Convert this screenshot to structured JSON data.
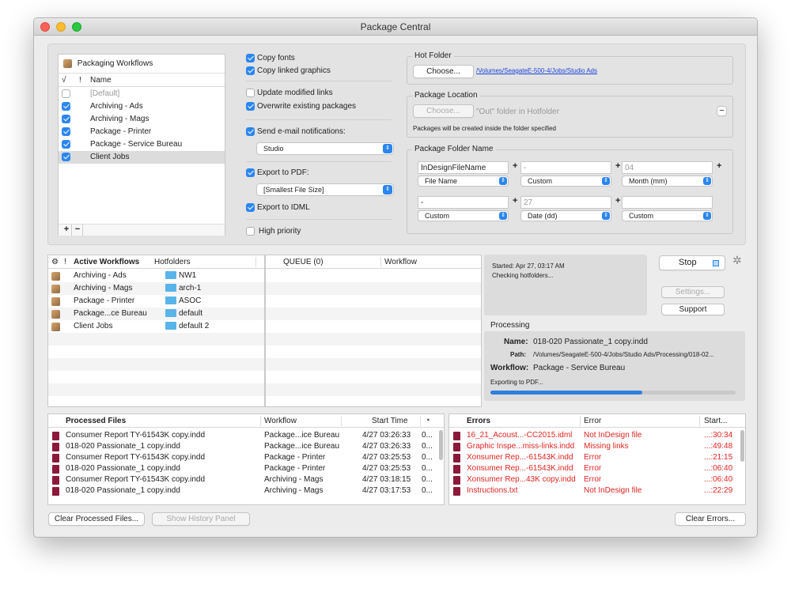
{
  "window": {
    "title": "Package Central"
  },
  "workflows": {
    "title": "Packaging Workflows",
    "col_check": "√",
    "col_bang": "!",
    "col_name": "Name",
    "items": [
      {
        "label": "[Default]",
        "checked": false
      },
      {
        "label": "Archiving - Ads",
        "checked": true
      },
      {
        "label": "Archiving - Mags",
        "checked": true
      },
      {
        "label": "Package - Printer",
        "checked": true
      },
      {
        "label": "Package - Service Bureau",
        "checked": true
      },
      {
        "label": "Client Jobs",
        "checked": true
      }
    ],
    "add_label": "+",
    "remove_label": "−"
  },
  "options": {
    "copy_fonts": "Copy fonts",
    "copy_graphics": "Copy linked graphics",
    "update_links": "Update modified links",
    "overwrite": "Overwrite existing packages",
    "send_email": "Send e-mail notifications:",
    "email_value": "Studio",
    "export_pdf": "Export to PDF:",
    "pdf_preset": "[Smallest File Size]",
    "export_idml": "Export to IDML",
    "high_priority": "High priority"
  },
  "hot_folder": {
    "legend": "Hot Folder",
    "choose": "Choose...",
    "path": "/Volumes/SeagateE-500-4/Jobs/Studio Ads"
  },
  "package_location": {
    "legend": "Package Location",
    "choose": "Choose...",
    "placeholder": "\"Out\" folder in Hotfolder",
    "note": "Packages will be created inside the folder specified",
    "remove": "−"
  },
  "folder_name": {
    "legend": "Package Folder Name",
    "plus": "+",
    "row1": [
      {
        "value": "InDesignFileName",
        "select": "File Name"
      },
      {
        "value": "-",
        "select": "Custom"
      },
      {
        "value": "04",
        "select": "Month (mm)"
      }
    ],
    "row2": [
      {
        "value": "-",
        "select": "Custom"
      },
      {
        "value": "27",
        "select": "Date (dd)"
      },
      {
        "value": "",
        "select": "Custom"
      }
    ]
  },
  "active": {
    "col_bang": "!",
    "col_active": "Active Workflows",
    "col_hot": "Hotfolders",
    "rows": [
      {
        "name": "Archiving - Ads",
        "folder": "NW1"
      },
      {
        "name": "Archiving - Mags",
        "folder": "arch-1"
      },
      {
        "name": "Package - Printer",
        "folder": "ASOC"
      },
      {
        "name": "Package...ce Bureau",
        "folder": "default"
      },
      {
        "name": "Client Jobs",
        "folder": "default 2"
      }
    ]
  },
  "queue": {
    "col_queue": "QUEUE (0)",
    "col_workflow": "Workflow"
  },
  "status": {
    "started": "Started: Apr 27, 03:17 AM",
    "checking": "Checking hotfolders...",
    "stop": "Stop",
    "settings": "Settings...",
    "support": "Support"
  },
  "processing": {
    "title": "Processing",
    "name_label": "Name:",
    "name_value": "018-020 Passionate_1 copy.indd",
    "path_label": "Path:",
    "path_value": "/Volumes/SeagateE-500-4/Jobs/Studio Ads/Processing/018-02...",
    "workflow_label": "Workflow:",
    "workflow_value": "Package - Service Bureau",
    "exporting": "Exporting to PDF...",
    "progress": 0.62
  },
  "processed": {
    "col_files": "Processed Files",
    "col_workflow": "Workflow",
    "col_start": "Start Time",
    "rows": [
      {
        "file": "Consumer Report TY-61543K copy.indd",
        "workflow": "Package...ice Bureau",
        "start": "4/27 03:26:33",
        "more": "0..."
      },
      {
        "file": "018-020 Passionate_1 copy.indd",
        "workflow": "Package...ice Bureau",
        "start": "4/27 03:26:33",
        "more": "0..."
      },
      {
        "file": "Consumer Report TY-61543K copy.indd",
        "workflow": "Package - Printer",
        "start": "4/27 03:25:53",
        "more": "0..."
      },
      {
        "file": "018-020 Passionate_1 copy.indd",
        "workflow": "Package - Printer",
        "start": "4/27 03:25:53",
        "more": "0..."
      },
      {
        "file": "Consumer Report TY-61543K copy.indd",
        "workflow": "Archiving - Mags",
        "start": "4/27 03:18:15",
        "more": "0..."
      },
      {
        "file": "018-020 Passionate_1 copy.indd",
        "workflow": "Archiving - Mags",
        "start": "4/27 03:17:53",
        "more": "0..."
      }
    ]
  },
  "errors": {
    "col_errors": "Errors",
    "col_error": "Error",
    "col_start": "Start...",
    "rows": [
      {
        "file": "16_21_Acoust...-CC2015.idml",
        "error": "Not InDesign file",
        "start": "...:30:34"
      },
      {
        "file": "Graphic Inspe...miss-links.indd",
        "error": "Missing links",
        "start": "...:49:48"
      },
      {
        "file": "Xonsumer Rep...-61543K.indd",
        "error": "Error",
        "start": "...:21:15"
      },
      {
        "file": "Xonsumer Rep...-61543K.indd",
        "error": "Error",
        "start": "...:06:40"
      },
      {
        "file": "Xonsumer Rep...43K copy.indd",
        "error": "Error",
        "start": "...:06:40"
      },
      {
        "file": "Instructions.txt",
        "error": "Not InDesign file",
        "start": "...:22:29"
      }
    ]
  },
  "footer": {
    "clear_processed": "Clear Processed Files...",
    "show_history": "Show History Panel",
    "clear_errors": "Clear Errors..."
  }
}
